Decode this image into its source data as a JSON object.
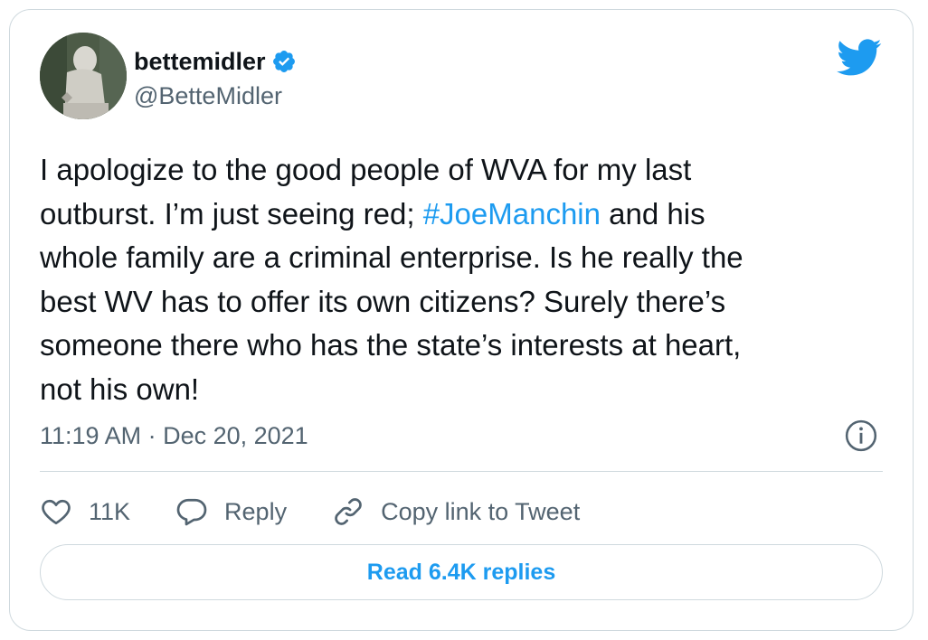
{
  "author": {
    "display_name": "bettemidler",
    "handle": "@BetteMidler",
    "verified": true,
    "avatar_icon": "statue-photo-avatar"
  },
  "tweet": {
    "text_before": "I apologize to the good people of WVA for my last\noutburst.  I’m just seeing red; ",
    "hashtag": "#JoeManchin",
    "text_after": " and his\nwhole family are a criminal enterprise.  Is he really the\nbest WV has to offer its own citizens? Surely there’s\nsomeone there who has the state’s interests at heart,\nnot his own!",
    "timestamp": "11:19 AM · Dec 20, 2021"
  },
  "actions": {
    "like_count": "11K",
    "reply_label": "Reply",
    "copy_link_label": "Copy link to Tweet"
  },
  "footer": {
    "read_replies_label": "Read 6.4K replies"
  },
  "colors": {
    "accent": "#1d9bf0",
    "secondary_text": "#536471",
    "border": "#cfd9de"
  },
  "icons": [
    "twitter-bird-icon",
    "verified-badge-icon",
    "info-icon",
    "heart-icon",
    "reply-bubble-icon",
    "link-icon"
  ]
}
